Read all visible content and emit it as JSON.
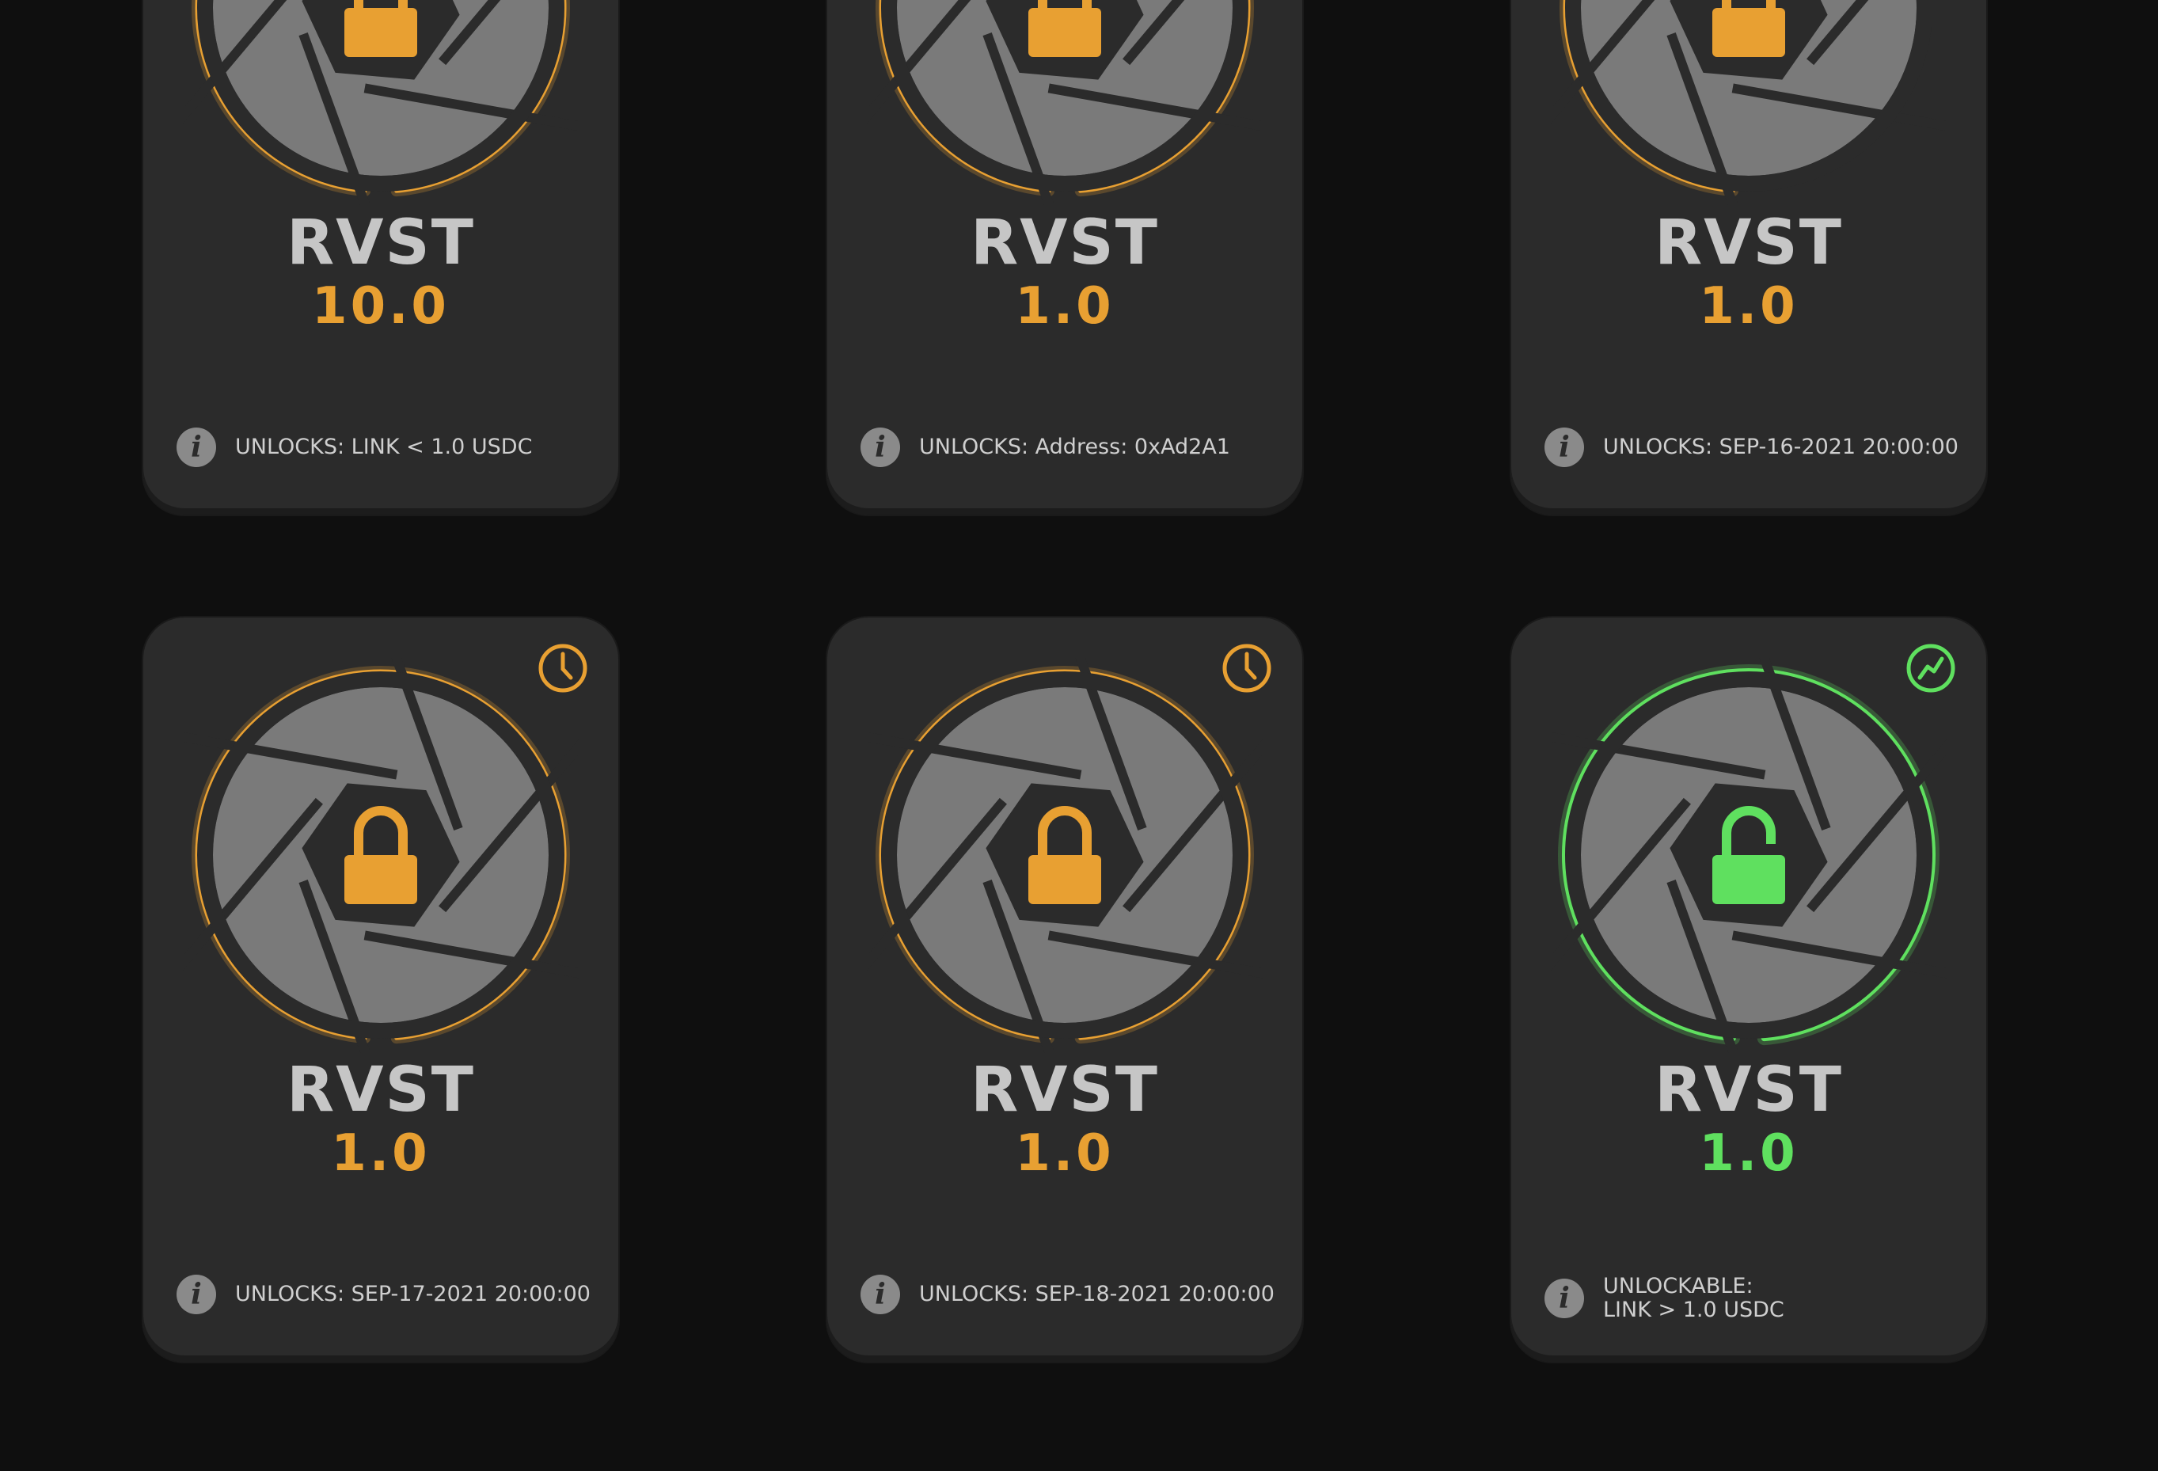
{
  "colors": {
    "locked": "#e8a032",
    "unlocked": "#5fe05f",
    "card": "#2b2b2b",
    "background": "#0f0f0f"
  },
  "cards": [
    {
      "ticker": "RVST",
      "amount": "10.0",
      "state": "locked",
      "info_icon": "info-icon",
      "unlock_text": "UNLOCKS: LINK < 1.0 USDC",
      "status_icon": null,
      "progress": 1.0
    },
    {
      "ticker": "RVST",
      "amount": "1.0",
      "state": "locked",
      "info_icon": "info-icon",
      "unlock_text": "UNLOCKS: Address: 0xAd2A1",
      "status_icon": null,
      "progress": 1.0
    },
    {
      "ticker": "RVST",
      "amount": "1.0",
      "state": "locked",
      "info_icon": "info-icon",
      "unlock_text": "UNLOCKS: SEP-16-2021 20:00:00",
      "status_icon": null,
      "progress": 0.35
    },
    {
      "ticker": "RVST",
      "amount": "1.0",
      "state": "locked",
      "info_icon": "info-icon",
      "unlock_text": "UNLOCKS: SEP-17-2021 20:00:00",
      "status_icon": "clock-icon",
      "progress": 1.0
    },
    {
      "ticker": "RVST",
      "amount": "1.0",
      "state": "locked",
      "info_icon": "info-icon",
      "unlock_text": "UNLOCKS: SEP-18-2021 20:00:00",
      "status_icon": "clock-icon",
      "progress": 1.0
    },
    {
      "ticker": "RVST",
      "amount": "1.0",
      "state": "unlocked",
      "info_icon": "info-icon",
      "unlock_text": "UNLOCKABLE:\nLINK > 1.0 USDC",
      "status_icon": "trend-up-icon",
      "progress": 1.0
    }
  ]
}
